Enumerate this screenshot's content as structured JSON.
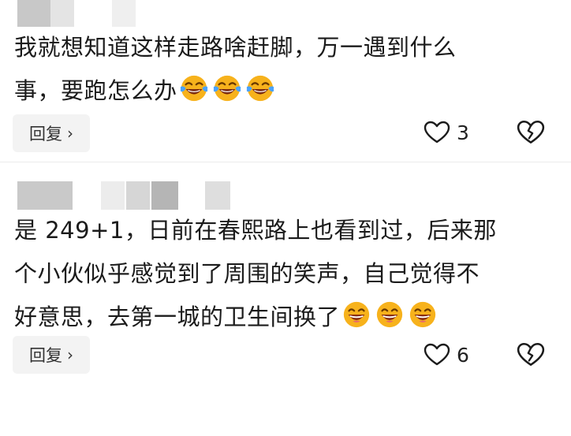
{
  "comments": [
    {
      "lines": [
        "我就想知道这样走路啥赶脚，万一遇到什么",
        "事，要跑怎么办"
      ],
      "emoji_icon": "laughing-tears-emoji",
      "reply_label": "回复",
      "like_count": "3"
    },
    {
      "lines": [
        "是 249+1，日前在春熙路上也看到过，后来那",
        "个小伙似乎感觉到了周围的笑声，自己觉得不",
        "好意思，去第一城的卫生间换了"
      ],
      "emoji_icon": "grinning-emoji",
      "reply_label": "回复",
      "like_count": "6"
    }
  ],
  "icons": {
    "like": "heart-icon",
    "dislike": "broken-heart-icon",
    "reply_chevron": "chevron-right-icon"
  },
  "colors": {
    "emoji_face": "#f7b21c",
    "blur_light": "#e6e6e6",
    "blur_dark": "#b9b9b9"
  }
}
